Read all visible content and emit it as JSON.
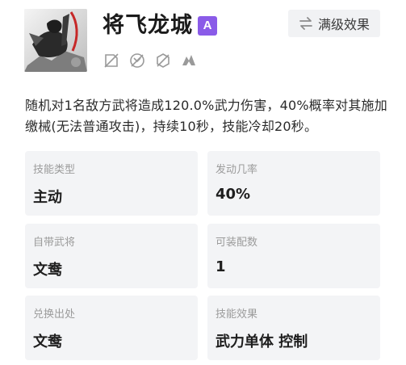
{
  "skill": {
    "name": "将飞龙城",
    "grade": "A",
    "max_level_button": "满级效果",
    "tag_icons": [
      "no-weapon-tag-icon",
      "no-counter-tag-icon",
      "no-heal-tag-icon",
      "troop-tag-icon"
    ],
    "description": "随机对1名敌方武将造成120.0%武力伤害，40%概率对其施加缴械(无法普通攻击)，持续10秒，技能冷却20秒。"
  },
  "cards": [
    {
      "label": "技能类型",
      "value": "主动"
    },
    {
      "label": "发动几率",
      "value": "40%"
    },
    {
      "label": "自带武将",
      "value": "文鸯"
    },
    {
      "label": "可装配数",
      "value": "1"
    },
    {
      "label": "兑换出处",
      "value": "文鸯"
    },
    {
      "label": "技能效果",
      "value": "武力单体 控制"
    }
  ],
  "colors": {
    "grade_badge": "#8a5be8",
    "card_bg": "#f3f4f6",
    "label_text": "#9b9b9b"
  }
}
